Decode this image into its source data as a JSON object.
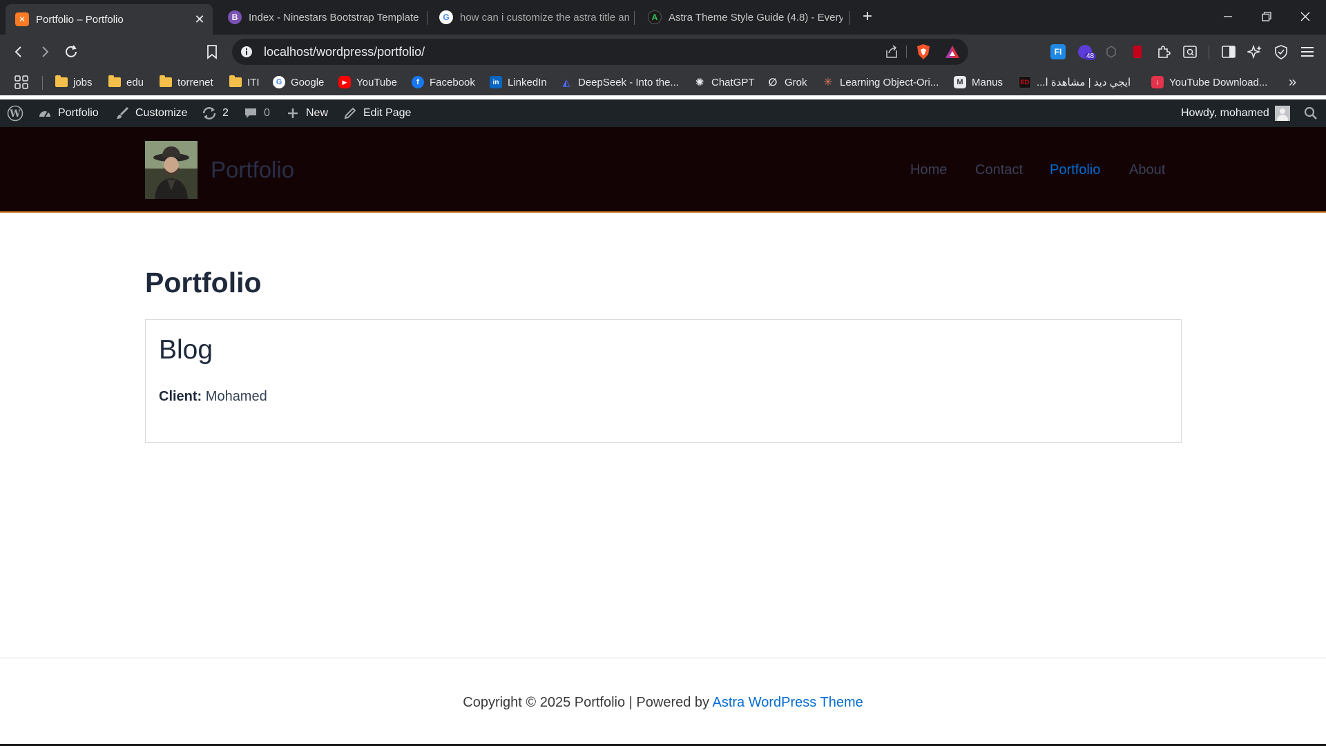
{
  "browser": {
    "tabs": [
      {
        "title": "Portfolio – Portfolio",
        "active": true,
        "favicon": "xampp-icon"
      },
      {
        "title": "Index - Ninestars Bootstrap Template",
        "active": false,
        "favicon": "bootstrap-icon"
      },
      {
        "title": "how can i customize the astra title an",
        "active": false,
        "favicon": "google-icon"
      },
      {
        "title": "Astra Theme Style Guide (4.8) - Every",
        "active": false,
        "favicon": "astra-icon"
      }
    ],
    "url": "localhost/wordpress/portfolio/",
    "extension_badge": "48",
    "extension_label": "FI",
    "bookmarks": [
      {
        "label": "jobs",
        "icon": "folder-icon"
      },
      {
        "label": "edu",
        "icon": "folder-icon"
      },
      {
        "label": "torrenet",
        "icon": "folder-icon"
      },
      {
        "label": "ITI",
        "icon": "folder-icon"
      },
      {
        "label": "Google",
        "icon": "google-icon"
      },
      {
        "label": "YouTube",
        "icon": "youtube-icon"
      },
      {
        "label": "Facebook",
        "icon": "facebook-icon"
      },
      {
        "label": "LinkedIn",
        "icon": "linkedin-icon"
      },
      {
        "label": "DeepSeek - Into the...",
        "icon": "deepseek-icon"
      },
      {
        "label": "ChatGPT",
        "icon": "chatgpt-icon"
      },
      {
        "label": "Grok",
        "icon": "grok-icon"
      },
      {
        "label": "Learning Object-Ori...",
        "icon": "claude-icon"
      },
      {
        "label": "Manus",
        "icon": "manus-icon"
      },
      {
        "label": "ايجي ديد | مشاهدة ا...",
        "icon": "egydead-icon"
      },
      {
        "label": "YouTube Download...",
        "icon": "download-icon"
      }
    ],
    "more_bookmarks": "»"
  },
  "adminbar": {
    "site": "Portfolio",
    "customize": "Customize",
    "updates": "2",
    "comments": "0",
    "new": "New",
    "edit": "Edit Page",
    "howdy": "Howdy, mohamed"
  },
  "site": {
    "title": "Portfolio",
    "menu": [
      "Home",
      "Contact",
      "Portfolio",
      "About"
    ],
    "current_menu": "Portfolio"
  },
  "page": {
    "title": "Portfolio",
    "card": {
      "title": "Blog",
      "client_label": "Client:",
      "client_value": "Mohamed"
    }
  },
  "footer": {
    "text": "Copyright © 2025 Portfolio | Powered by",
    "link": "Astra WordPress Theme"
  },
  "colors": {
    "header_bg": "#130305",
    "header_border": "#d17a28",
    "accent": "#046bd2",
    "adminbar_bg": "#1d2327"
  }
}
